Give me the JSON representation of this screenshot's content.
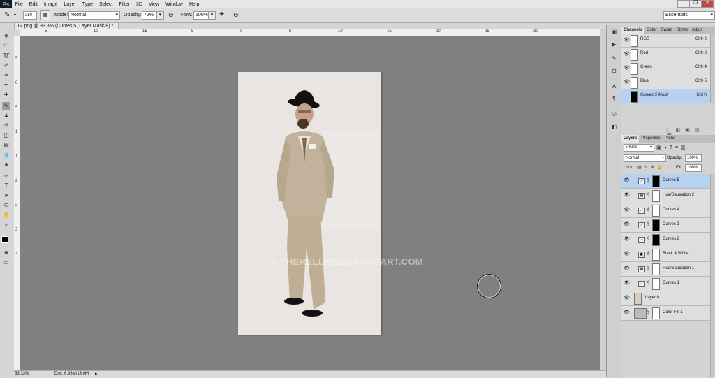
{
  "app": {
    "logo": "Ps"
  },
  "menu": [
    "File",
    "Edit",
    "Image",
    "Layer",
    "Type",
    "Select",
    "Filter",
    "3D",
    "View",
    "Window",
    "Help"
  ],
  "window_buttons": [
    "–",
    "❐",
    "✕"
  ],
  "options": {
    "brush_size": "250",
    "mode_label": "Mode:",
    "mode_value": "Normal",
    "opacity_label": "Opacity:",
    "opacity_value": "72%",
    "flow_label": "Flow:",
    "flow_value": "100%",
    "workspace": "Essentials"
  },
  "document": {
    "tab_title": "JR.png @ 33.3% (Curves 5, Layer Mask/8) *",
    "tab_close": "×",
    "ruler_top": [
      "5",
      "10",
      "15",
      "5",
      "0",
      "5",
      "10",
      "15",
      "20",
      "25",
      "30"
    ],
    "ruler_left": [
      "5",
      "0",
      "5",
      "1",
      "1",
      "2",
      "2",
      "3",
      "4"
    ],
    "watermark": "© THERELLER.DEVIANTART.COM",
    "zoom": "33.33%",
    "doc_info": "Doc: 6.93M/13.0M"
  },
  "channels_panel": {
    "tabs": [
      "Channels",
      "Color",
      "Swatc",
      "Styles",
      "Adjus"
    ],
    "rows": [
      {
        "name": "RGB",
        "shortcut": "Ctrl+2"
      },
      {
        "name": "Red",
        "shortcut": "Ctrl+3"
      },
      {
        "name": "Green",
        "shortcut": "Ctrl+4"
      },
      {
        "name": "Blue",
        "shortcut": "Ctrl+5"
      },
      {
        "name": "Curves 5 Mask",
        "shortcut": "Ctrl+\\"
      }
    ]
  },
  "layers_panel": {
    "tabs": [
      "Layers",
      "Properties",
      "Paths"
    ],
    "kind": "Kind",
    "blend_mode": "Normal",
    "opacity_label": "Opacity:",
    "opacity_value": "100%",
    "lock_label": "Lock:",
    "fill_label": "Fill:",
    "fill_value": "100%",
    "layers": [
      {
        "name": "Curves 5"
      },
      {
        "name": "Hue/Saturation 2"
      },
      {
        "name": "Curves 4"
      },
      {
        "name": "Curves 3"
      },
      {
        "name": "Curves 2"
      },
      {
        "name": "Black & White 1"
      },
      {
        "name": "Hue/Saturation 1"
      },
      {
        "name": "Curves 1"
      },
      {
        "name": "Layer 0"
      },
      {
        "name": "Color Fill 1"
      }
    ]
  }
}
